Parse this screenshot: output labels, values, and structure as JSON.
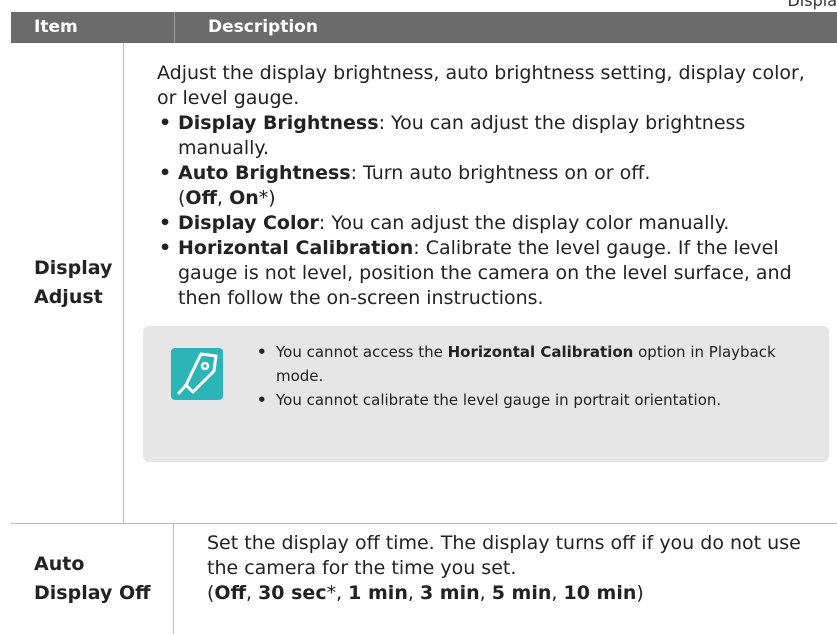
{
  "corner_label": "Displa",
  "table": {
    "headers": {
      "item": "Item",
      "description": "Description"
    },
    "rows": [
      {
        "item": "Display Adjust",
        "intro": "Adjust the display brightness, auto brightness setting, display color, or level gauge.",
        "bullets": [
          {
            "term": "Display Brightness",
            "text": ": You can adjust the display brightness manually."
          },
          {
            "term": "Auto Brightness",
            "text": ": Turn auto brightness on or off.",
            "options": "(Off, On*)"
          },
          {
            "term": "Display Color",
            "text": ": You can adjust the display color manually."
          },
          {
            "term": "Horizontal Calibration",
            "text": ": Calibrate the level gauge. If the level gauge is not level, position the camera on the level surface, and then follow the on-screen instructions."
          }
        ],
        "note": {
          "icon": "pen-nib-note-icon",
          "items": [
            {
              "pre": "You cannot access the ",
              "term": "Horizontal Calibration",
              "post": " option in Playback mode."
            },
            {
              "text": "You cannot calibrate the level gauge in portrait orientation."
            }
          ]
        }
      },
      {
        "item": "Auto Display Off",
        "text": "Set the display off time. The display turns off if you do not use the camera for the time you set.",
        "options": [
          "Off",
          "30 sec*",
          "1 min",
          "3 min",
          "5 min",
          "10 min"
        ]
      }
    ]
  },
  "colors": {
    "header_bg": "#6b6b6b",
    "note_bg": "#e6e6e6",
    "icon_bg": "#2bb5b7"
  }
}
